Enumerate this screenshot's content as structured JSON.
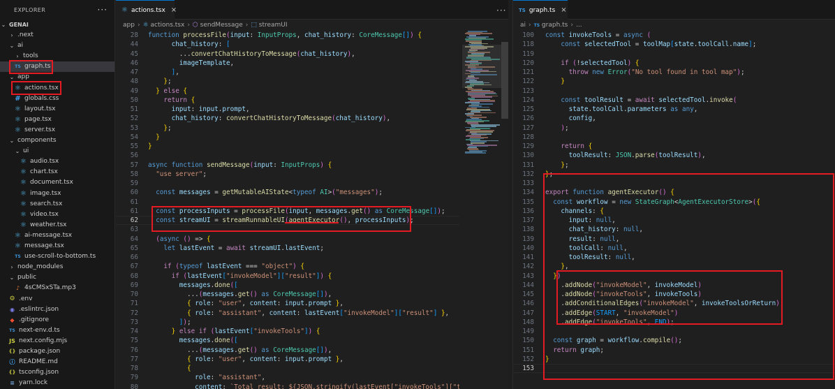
{
  "explorer": {
    "title": "EXPLORER",
    "more": "···",
    "root": "GENAI",
    "items": [
      {
        "label": ".next",
        "icon": "chevron-right-icon",
        "depth": 1,
        "folder": true
      },
      {
        "label": "ai",
        "icon": "chevron-down-icon",
        "depth": 1,
        "folder": true
      },
      {
        "label": "tools",
        "icon": "chevron-right-icon",
        "depth": 2,
        "folder": true
      },
      {
        "label": "graph.ts",
        "icon": "ts-file-icon",
        "depth": 2,
        "type": "ts"
      },
      {
        "label": "app",
        "icon": "chevron-down-icon",
        "depth": 1,
        "folder": true
      },
      {
        "label": "actions.tsx",
        "icon": "react-file-icon",
        "depth": 2,
        "type": "tsx"
      },
      {
        "label": "globals.css",
        "icon": "css-file-icon",
        "depth": 2,
        "type": "css"
      },
      {
        "label": "layout.tsx",
        "icon": "react-file-icon",
        "depth": 2,
        "type": "tsx"
      },
      {
        "label": "page.tsx",
        "icon": "react-file-icon",
        "depth": 2,
        "type": "tsx"
      },
      {
        "label": "server.tsx",
        "icon": "react-file-icon",
        "depth": 2,
        "type": "tsx"
      },
      {
        "label": "components",
        "icon": "chevron-down-icon",
        "depth": 1,
        "folder": true
      },
      {
        "label": "ui",
        "icon": "chevron-down-icon",
        "depth": 2,
        "folder": true
      },
      {
        "label": "audio.tsx",
        "icon": "react-file-icon",
        "depth": 3,
        "type": "tsx"
      },
      {
        "label": "chart.tsx",
        "icon": "react-file-icon",
        "depth": 3,
        "type": "tsx"
      },
      {
        "label": "document.tsx",
        "icon": "react-file-icon",
        "depth": 3,
        "type": "tsx"
      },
      {
        "label": "image.tsx",
        "icon": "react-file-icon",
        "depth": 3,
        "type": "tsx"
      },
      {
        "label": "search.tsx",
        "icon": "react-file-icon",
        "depth": 3,
        "type": "tsx"
      },
      {
        "label": "video.tsx",
        "icon": "react-file-icon",
        "depth": 3,
        "type": "tsx"
      },
      {
        "label": "weather.tsx",
        "icon": "react-file-icon",
        "depth": 3,
        "type": "tsx"
      },
      {
        "label": "ai-message.tsx",
        "icon": "react-file-icon",
        "depth": 2,
        "type": "tsx"
      },
      {
        "label": "message.tsx",
        "icon": "react-file-icon",
        "depth": 2,
        "type": "tsx"
      },
      {
        "label": "use-scroll-to-bottom.ts",
        "icon": "ts-file-icon",
        "depth": 2,
        "type": "ts"
      },
      {
        "label": "node_modules",
        "icon": "chevron-right-icon",
        "depth": 1,
        "folder": true
      },
      {
        "label": "public",
        "icon": "chevron-down-icon",
        "depth": 1,
        "folder": true
      },
      {
        "label": "4sCMSxSTa.mp3",
        "icon": "audio-file-icon",
        "depth": 2,
        "type": "mp3"
      },
      {
        "label": ".env",
        "icon": "env-file-icon",
        "depth": 1,
        "type": "env"
      },
      {
        "label": ".eslintrc.json",
        "icon": "eslint-file-icon",
        "depth": 1,
        "type": "eslint"
      },
      {
        "label": ".gitignore",
        "icon": "git-file-icon",
        "depth": 1,
        "type": "git"
      },
      {
        "label": "next-env.d.ts",
        "icon": "ts-file-icon",
        "depth": 1,
        "type": "ts"
      },
      {
        "label": "next.config.mjs",
        "icon": "js-file-icon",
        "depth": 1,
        "type": "mjs"
      },
      {
        "label": "package.json",
        "icon": "json-file-icon",
        "depth": 1,
        "type": "json"
      },
      {
        "label": "README.md",
        "icon": "markdown-file-icon",
        "depth": 1,
        "type": "md"
      },
      {
        "label": "tsconfig.json",
        "icon": "json-file-icon",
        "depth": 1,
        "type": "json"
      },
      {
        "label": "yarn.lock",
        "icon": "lock-file-icon",
        "depth": 1,
        "type": "lock"
      }
    ]
  },
  "left_editor": {
    "tab": {
      "label": "actions.tsx",
      "icon": "react-file-icon",
      "close": "×"
    },
    "more": "···",
    "breadcrumb": [
      "app",
      "actions.tsx",
      "sendMessage",
      "streamUI"
    ],
    "active_line": 62,
    "lines": [
      {
        "n": "28",
        "t": "function processFile(input: InputProps, chat_history: CoreMessage[]) {"
      },
      {
        "n": "44",
        "t": "      chat_history: ["
      },
      {
        "n": "45",
        "t": "        ...convertChatHistoryToMessage(chat_history),"
      },
      {
        "n": "46",
        "t": "        imageTemplate,"
      },
      {
        "n": "47",
        "t": "      ],"
      },
      {
        "n": "48",
        "t": "    };"
      },
      {
        "n": "49",
        "t": "  } else {"
      },
      {
        "n": "50",
        "t": "    return {"
      },
      {
        "n": "51",
        "t": "      input: input.prompt,"
      },
      {
        "n": "52",
        "t": "      chat_history: convertChatHistoryToMessage(chat_history),"
      },
      {
        "n": "53",
        "t": "    };"
      },
      {
        "n": "54",
        "t": "  }"
      },
      {
        "n": "55",
        "t": "}"
      },
      {
        "n": "56",
        "t": ""
      },
      {
        "n": "57",
        "t": "async function sendMessage(input: InputProps) {"
      },
      {
        "n": "58",
        "t": "  \"use server\";"
      },
      {
        "n": "59",
        "t": ""
      },
      {
        "n": "60",
        "t": "  const messages = getMutableAIState<typeof AI>(\"messages\");"
      },
      {
        "n": "61",
        "t": ""
      },
      {
        "n": "61",
        "t": "  const processInputs = processFile(input, messages.get() as CoreMessage[]);"
      },
      {
        "n": "62",
        "t": "  const streamUI = streamRunnableUI(agentExecutor(), processInputs);"
      },
      {
        "n": "63",
        "t": ""
      },
      {
        "n": "64",
        "t": "  (async () => {"
      },
      {
        "n": "65",
        "t": "    let lastEvent = await streamUI.lastEvent;"
      },
      {
        "n": "66",
        "t": ""
      },
      {
        "n": "67",
        "t": "    if (typeof lastEvent === \"object\") {"
      },
      {
        "n": "68",
        "t": "      if (lastEvent[\"invokeModel\"][\"result\"]) {"
      },
      {
        "n": "69",
        "t": "        messages.done(["
      },
      {
        "n": "70",
        "t": "          ...(messages.get() as CoreMessage[]),"
      },
      {
        "n": "71",
        "t": "          { role: \"user\", content: input.prompt },"
      },
      {
        "n": "72",
        "t": "          { role: \"assistant\", content: lastEvent[\"invokeModel\"][\"result\"] },"
      },
      {
        "n": "73",
        "t": "        ]);"
      },
      {
        "n": "74",
        "t": "      } else if (lastEvent[\"invokeTools\"]) {"
      },
      {
        "n": "75",
        "t": "        messages.done(["
      },
      {
        "n": "76",
        "t": "          ...(messages.get() as CoreMessage[]),"
      },
      {
        "n": "77",
        "t": "          { role: \"user\", content: input.prompt },"
      },
      {
        "n": "78",
        "t": "          {"
      },
      {
        "n": "79",
        "t": "            role: \"assistant\","
      },
      {
        "n": "80",
        "t": "            content: `Total result: ${JSON.stringify(lastEvent[\"invokeTools\"][\"toolRe"
      },
      {
        "n": "81",
        "t": "          },"
      }
    ]
  },
  "right_editor": {
    "tab": {
      "label": "graph.ts",
      "icon": "ts-file-icon",
      "close": "×"
    },
    "breadcrumb": [
      "ai",
      "graph.ts",
      "..."
    ],
    "active_line": 153,
    "lines": [
      {
        "n": "100",
        "t": "const invokeTools = async ("
      },
      {
        "n": "118",
        "t": "    const selectedTool = toolMap[state.toolCall.name];"
      },
      {
        "n": "119",
        "t": ""
      },
      {
        "n": "120",
        "t": "    if (!selectedTool) {"
      },
      {
        "n": "121",
        "t": "      throw new Error(\"No tool found in tool map\");"
      },
      {
        "n": "122",
        "t": "    }"
      },
      {
        "n": "123",
        "t": ""
      },
      {
        "n": "124",
        "t": "    const toolResult = await selectedTool.invoke("
      },
      {
        "n": "125",
        "t": "      state.toolCall.parameters as any,"
      },
      {
        "n": "126",
        "t": "      config,"
      },
      {
        "n": "127",
        "t": "    );"
      },
      {
        "n": "128",
        "t": ""
      },
      {
        "n": "129",
        "t": "    return {"
      },
      {
        "n": "130",
        "t": "      toolResult: JSON.parse(toolResult),"
      },
      {
        "n": "131",
        "t": "    };"
      },
      {
        "n": "132",
        "t": "};"
      },
      {
        "n": "133",
        "t": ""
      },
      {
        "n": "134",
        "t": "export function agentExecutor() {"
      },
      {
        "n": "135",
        "t": "  const workflow = new StateGraph<AgentExecutorStore>({"
      },
      {
        "n": "136",
        "t": "    channels: {"
      },
      {
        "n": "137",
        "t": "      input: null,"
      },
      {
        "n": "138",
        "t": "      chat_history: null,"
      },
      {
        "n": "139",
        "t": "      result: null,"
      },
      {
        "n": "140",
        "t": "      toolCall: null,"
      },
      {
        "n": "141",
        "t": "      toolResult: null,"
      },
      {
        "n": "142",
        "t": "    },"
      },
      {
        "n": "143",
        "t": "  })"
      },
      {
        "n": "144",
        "t": "    .addNode(\"invokeModel\", invokeModel)"
      },
      {
        "n": "145",
        "t": "    .addNode(\"invokeTools\", invokeTools)"
      },
      {
        "n": "146",
        "t": "    .addConditionalEdges(\"invokeModel\", invokeToolsOrReturn)"
      },
      {
        "n": "147",
        "t": "    .addEdge(START, \"invokeModel\")"
      },
      {
        "n": "148",
        "t": "    .addEdge(\"invokeTools\", END);"
      },
      {
        "n": "149",
        "t": ""
      },
      {
        "n": "150",
        "t": "  const graph = workflow.compile();"
      },
      {
        "n": "151",
        "t": "  return graph;"
      },
      {
        "n": "152",
        "t": "}"
      },
      {
        "n": "153",
        "t": ""
      }
    ]
  },
  "colors": {
    "highlight_box": "#e51b24",
    "editor_bg": "#1f1f1f",
    "sidebar_bg": "#181818",
    "tab_accent": "#0078d4"
  }
}
